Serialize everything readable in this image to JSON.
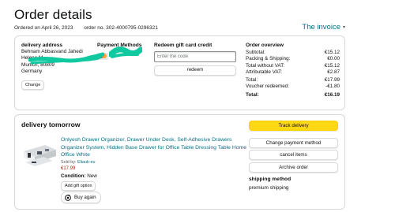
{
  "page": {
    "title": "Order details",
    "ordered_on": "Ordered on April 26, 2023",
    "order_no": "order no. 302-4000795-0296321",
    "invoice_label": "The invoice"
  },
  "summary": {
    "address": {
      "heading": "delivery address",
      "lines": [
        "Behnam Abbasvand Jahedi",
        "Helene M",
        "Munich, 80809",
        "Germany"
      ],
      "change_label": "Change"
    },
    "payment": {
      "heading": "Payment Methods",
      "card_suffix": "3"
    },
    "gift_card": {
      "heading": "Redeem gift card credit",
      "placeholder": "Enter the code",
      "redeem_label": "redeem"
    },
    "overview": {
      "heading": "Order overview",
      "rows": [
        {
          "label": "Subtotal:",
          "value": "€15.12"
        },
        {
          "label": "Packing & Shipping:",
          "value": "€0.00"
        },
        {
          "label": "Total without VAT:",
          "value": "€15.12"
        },
        {
          "label": "Attributable VAT:",
          "value": "€2.87"
        },
        {
          "label": "Total:",
          "value": "€17.99"
        },
        {
          "label": "Voucher redeemed:",
          "value": "-€1.80"
        },
        {
          "label": "Total:",
          "value": "€16.19"
        }
      ]
    }
  },
  "delivery": {
    "heading": "delivery tomorrow",
    "product": {
      "title": "Onlyesh Drawer Organizer, Drawer Under Desk, Self-Adhesive Drawers Organizer System, Hidden Base Drawer for Office Table Dressing Table Home Office White",
      "sold_by_label": "Sold by:",
      "seller": "Eliauk-eu",
      "price": "€17.99",
      "condition_label": "Condition:",
      "condition_value": "New",
      "gift_option_label": "Add gift option",
      "buy_again_label": "Buy again"
    },
    "actions": {
      "track": "Track delivery",
      "change_payment": "Change payment method",
      "cancel": "cancel items",
      "archive": "Archive order"
    },
    "shipping": {
      "heading": "shipping method",
      "value": "premium shipping"
    }
  },
  "colors": {
    "link": "#007185",
    "price": "#b12704",
    "primary_button": "#ffd814",
    "redaction": "#10c9a0"
  }
}
